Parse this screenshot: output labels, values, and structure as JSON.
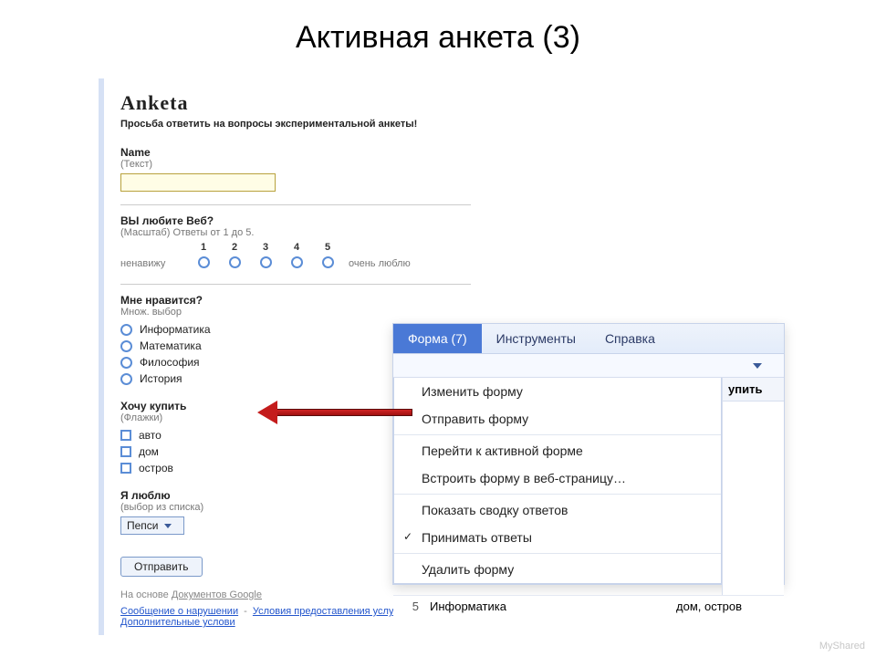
{
  "slide": {
    "title": "Активная анкета (3)"
  },
  "form": {
    "title": "Anketa",
    "desc": "Просьба ответить на вопросы экспериментальной анкеты!",
    "q_name": {
      "label": "Name",
      "hint": "(Текст)",
      "value": ""
    },
    "q_scale": {
      "label": "ВЫ любите Веб?",
      "hint": "(Масштаб) Ответы от 1 до 5.",
      "low": "ненавижу",
      "high": "очень люблю",
      "nums": [
        "1",
        "2",
        "3",
        "4",
        "5"
      ]
    },
    "q_like": {
      "label": "Мне нравится?",
      "hint": "Множ. выбор",
      "options": [
        "Информатика",
        "Математика",
        "Философия",
        "История"
      ]
    },
    "q_buy": {
      "label": "Хочу купить",
      "hint": "(Флажки)",
      "options": [
        "авто",
        "дом",
        "остров"
      ]
    },
    "q_love": {
      "label": "Я люблю",
      "hint": "(выбор из списка)",
      "selected": "Пепси"
    },
    "submit": "Отправить",
    "footer_prefix": "На основе ",
    "footer_doclink": "Документов Google",
    "links": {
      "report": "Сообщение о нарушении",
      "terms": "Условия предоставления услуг",
      "extra": "Дополнительные услови"
    }
  },
  "popup": {
    "menubar": {
      "form": "Форма (7)",
      "tools": "Инструменты",
      "help": "Справка"
    },
    "items": {
      "edit": "Изменить форму",
      "send": "Отправить форму",
      "goto": "Перейти к активной форме",
      "embed": "Встроить форму в веб-страницу…",
      "summary": "Показать сводку ответов",
      "accept": "Принимать ответы",
      "delete": "Удалить форму"
    },
    "bg_col_header": "упить",
    "bg_row": {
      "num": "5",
      "subj": "Информатика",
      "buy": "дом, остров"
    }
  },
  "watermark": "MyShared"
}
